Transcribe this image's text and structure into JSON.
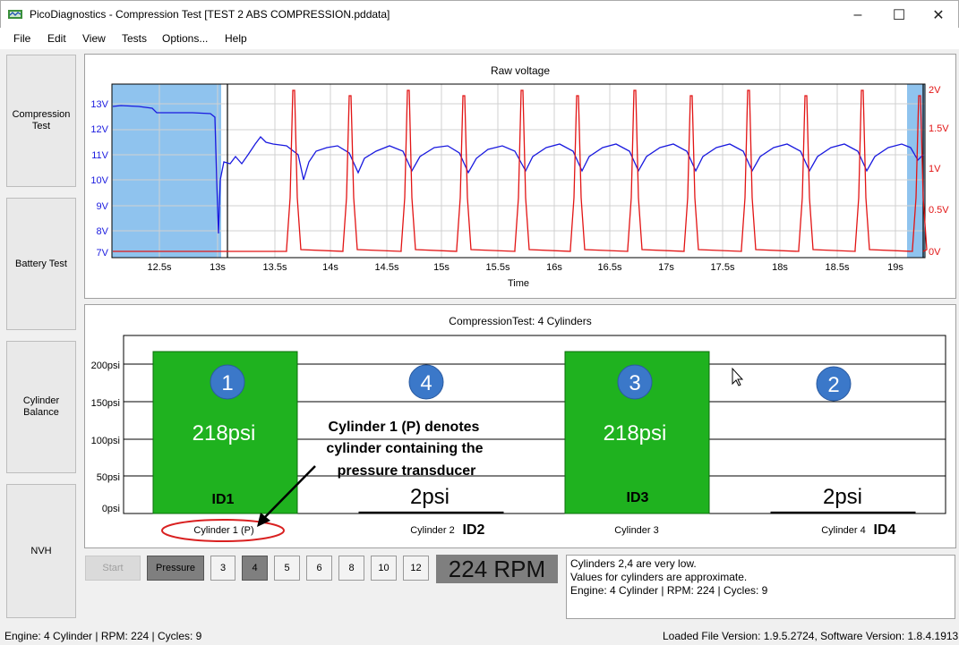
{
  "window": {
    "title": "PicoDiagnostics - Compression Test [TEST 2 ABS COMPRESSION.pddata]",
    "app_icon": "pico-app-icon",
    "minimize": "–",
    "maximize": "☐",
    "close": "✕"
  },
  "menu": [
    "File",
    "Edit",
    "View",
    "Tests",
    "Options...",
    "Help"
  ],
  "sidebar": [
    "Compression Test",
    "Battery Test",
    "Cylinder Balance",
    "NVH"
  ],
  "raw_chart": {
    "title": "Raw voltage",
    "xlabel": "Time",
    "x_ticks": [
      "12.5s",
      "13s",
      "13.5s",
      "14s",
      "14.5s",
      "15s",
      "15.5s",
      "16s",
      "16.5s",
      "17s",
      "17.5s",
      "18s",
      "18.5s",
      "19s"
    ],
    "y_left_ticks": [
      "13V",
      "12V",
      "11V",
      "10V",
      "9V",
      "8V",
      "7V"
    ],
    "y_right_ticks": [
      "2V",
      "1.5V",
      "1V",
      "0.5V",
      "0V"
    ],
    "colors": {
      "left_series": "#1a1adf",
      "right_series": "#e21414",
      "selection": "#8fc3ee"
    }
  },
  "compression_chart": {
    "title": "CompressionTest: 4 Cylinders",
    "y_ticks": [
      "200psi",
      "150psi",
      "100psi",
      "50psi",
      "0psi"
    ],
    "bars": [
      {
        "badge": "1",
        "value_label": "218psi",
        "id_label": "ID1",
        "cylinder": "Cylinder 1 (P)",
        "bar_id": ""
      },
      {
        "badge": "4",
        "value_label": "2psi",
        "id_label": "",
        "cylinder": "Cylinder 2",
        "bar_id": "ID2"
      },
      {
        "badge": "3",
        "value_label": "218psi",
        "id_label": "ID3",
        "cylinder": "Cylinder 3",
        "bar_id": ""
      },
      {
        "badge": "2",
        "value_label": "2psi",
        "id_label": "",
        "cylinder": "Cylinder 4",
        "bar_id": "ID4"
      }
    ],
    "annotation": [
      "Cylinder 1 (P) denotes",
      "cylinder containing  the",
      "pressure transducer"
    ],
    "colors": {
      "bar_fill": "#1fb21f",
      "badge": "#3b78c9"
    }
  },
  "chart_data": {
    "type": "bar",
    "categories": [
      "Cylinder 1 (P)",
      "Cylinder 2",
      "Cylinder 3",
      "Cylinder 4"
    ],
    "values": [
      218,
      2,
      218,
      2
    ],
    "ylabel": "",
    "ylim": [
      0,
      218
    ]
  },
  "controls": {
    "start": "Start",
    "pressure": "Pressure",
    "cylinder_counts": [
      "3",
      "4",
      "5",
      "6",
      "8",
      "10",
      "12"
    ],
    "selected_count": "4",
    "rpm": "224 RPM"
  },
  "messages": [
    "Cylinders 2,4 are very low.",
    "Values for cylinders are approximate.",
    "Engine: 4 Cylinder | RPM: 224 | Cycles: 9"
  ],
  "status": {
    "left": "Engine: 4 Cylinder | RPM: 224 | Cycles: 9",
    "right": "Loaded File Version: 1.9.5.2724,   Software Version: 1.8.4.1913"
  }
}
